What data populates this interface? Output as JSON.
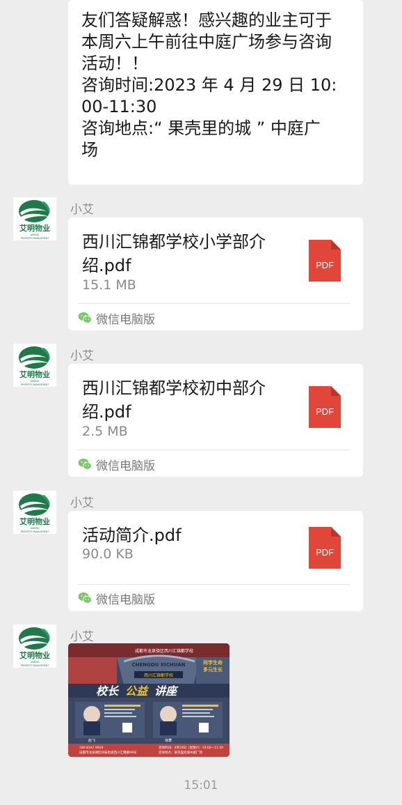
{
  "announcement": {
    "lines": [
      "友们答疑解惑！感兴趣的业主可于",
      "本周六上午前往中庭广场参与咨询",
      "活动！！",
      "咨询时间:2023 年 4 月 29 日 10:",
      "00-11:30",
      "咨询地点:“ 果壳里的城 ” 中庭广",
      "场"
    ]
  },
  "avatar": {
    "brand_name": "艾明物业",
    "english_line1": "AIMING",
    "english_line2": "PROPERTY MANAGEMENT",
    "brand_color": "#1f7a4a"
  },
  "messages": [
    {
      "sender": "小艾",
      "file_lines": [
        "西川汇锦都学校小学部介",
        "绍.pdf"
      ],
      "size": "15.1 MB",
      "source": "微信电脑版",
      "icon": "pdf-icon",
      "icon_label": "PDF"
    },
    {
      "sender": "小艾",
      "file_lines": [
        "西川汇锦都学校初中部介",
        "绍.pdf"
      ],
      "size": "2.5 MB",
      "source": "微信电脑版",
      "icon": "pdf-icon",
      "icon_label": "PDF"
    },
    {
      "sender": "小艾",
      "file_lines": [
        "活动简介.pdf"
      ],
      "size": "90.0 KB",
      "source": "微信电脑版",
      "icon": "pdf-icon",
      "icon_label": "PDF"
    },
    {
      "sender": "小艾"
    }
  ],
  "poster": {
    "header": "成都市龙泉驿区西川汇锦都学校",
    "arch_sign": "CHENGDU XICHUAN",
    "plaque": "西川汇锦都学校",
    "slogan_line1": "同学生命",
    "slogan_line2": "多元生长",
    "title_part1": "校长",
    "title_part2": "公益",
    "title_part3": "讲座",
    "speaker1_name": "赵飞",
    "speaker2_name": "徐攀",
    "footer_phone": "180 8342 9918",
    "footer_address": "成都市龙泉驿区同安街道西川汇锦都99号",
    "footer_time": "咨询时间：4月29日（星期六）10:00—11:30",
    "footer_place": "咨询地点：果壳里的城中庭广场",
    "colors": {
      "bg": "#3d4962",
      "banner": "#c2423d",
      "accent": "#f2c233"
    }
  },
  "timestamp": "15:01",
  "pdf_color": "#e0473a",
  "wechat_color": "#7bc86c"
}
